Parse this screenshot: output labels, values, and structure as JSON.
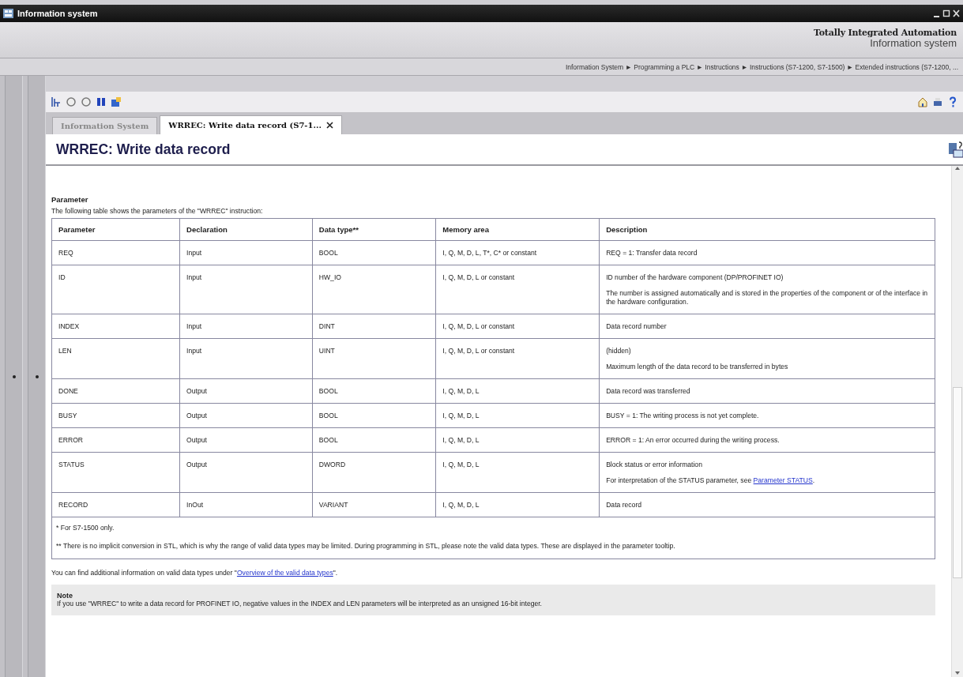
{
  "window": {
    "title": "Information system"
  },
  "header": {
    "brand": "Totally Integrated Automation",
    "product": "Information system"
  },
  "breadcrumb": "Information System ► Programming a PLC ► Instructions ► Instructions (S7-1200, S7-1500) ► Extended instructions (S7-1200, ...",
  "tabs": [
    {
      "label": "Information System",
      "selected": false,
      "closable": false
    },
    {
      "label": "WRREC: Write data record (S7-1...",
      "selected": true,
      "closable": true
    }
  ],
  "page_title": "WRREC: Write data record",
  "section": {
    "heading": "Parameter",
    "intro": "The following table shows the parameters of the \"WRREC\" instruction:"
  },
  "table": {
    "columns": [
      "Parameter",
      "Declaration",
      "Data type**",
      "Memory area",
      "Description"
    ],
    "rows": [
      {
        "cells": [
          "REQ",
          "Input",
          "BOOL",
          "I, Q, M, D, L, T*, C* or constant"
        ],
        "description": [
          {
            "text": "REQ = 1: Transfer data record"
          }
        ]
      },
      {
        "cells": [
          "ID",
          "Input",
          "HW_IO",
          "I, Q, M, D, L or constant"
        ],
        "description": [
          {
            "text": "ID number of the hardware component (DP/PROFINET IO)"
          },
          {
            "text": "The number is assigned automatically and is stored in the properties of the component or of the interface in the hardware configuration."
          }
        ]
      },
      {
        "cells": [
          "INDEX",
          "Input",
          "DINT",
          "I, Q, M, D, L or constant"
        ],
        "description": [
          {
            "text": "Data record number"
          }
        ]
      },
      {
        "cells": [
          "LEN",
          "Input",
          "UINT",
          "I, Q, M, D, L or constant"
        ],
        "description": [
          {
            "text": "(hidden)"
          },
          {
            "text": "Maximum length of the data record to be transferred in bytes"
          }
        ]
      },
      {
        "cells": [
          "DONE",
          "Output",
          "BOOL",
          "I, Q, M, D, L"
        ],
        "description": [
          {
            "text": "Data record was transferred"
          }
        ]
      },
      {
        "cells": [
          "BUSY",
          "Output",
          "BOOL",
          "I, Q, M, D, L"
        ],
        "description": [
          {
            "text": "BUSY = 1: The writing process is not yet complete."
          }
        ]
      },
      {
        "cells": [
          "ERROR",
          "Output",
          "BOOL",
          "I, Q, M, D, L"
        ],
        "description": [
          {
            "text": "ERROR = 1: An error occurred during the writing process."
          }
        ]
      },
      {
        "cells": [
          "STATUS",
          "Output",
          "DWORD",
          "I, Q, M, D, L"
        ],
        "description": [
          {
            "text": "Block status or error information"
          },
          {
            "text": "For interpretation of the STATUS parameter, see ",
            "link": "Parameter STATUS",
            "after": "."
          }
        ]
      },
      {
        "cells": [
          "RECORD",
          "InOut",
          "VARIANT",
          "I, Q, M, D, L"
        ],
        "description": [
          {
            "text": "Data record"
          }
        ]
      }
    ],
    "footnotes": [
      "* For S7-1500 only.",
      "** There is no implicit conversion in STL, which is why the range of valid data types may be limited. During programming in STL, please note the valid data types. These are displayed in the parameter tooltip."
    ]
  },
  "more_info": {
    "text": "You can find additional information on valid data types under \"",
    "link": "Overview of the valid data types",
    "after": "\"."
  },
  "note": {
    "heading": "Note",
    "text": "If you use \"WRREC\" to write a data record for PROFINET IO, negative values in the INDEX and LEN parameters will be interpreted as an unsigned 16-bit integer."
  }
}
